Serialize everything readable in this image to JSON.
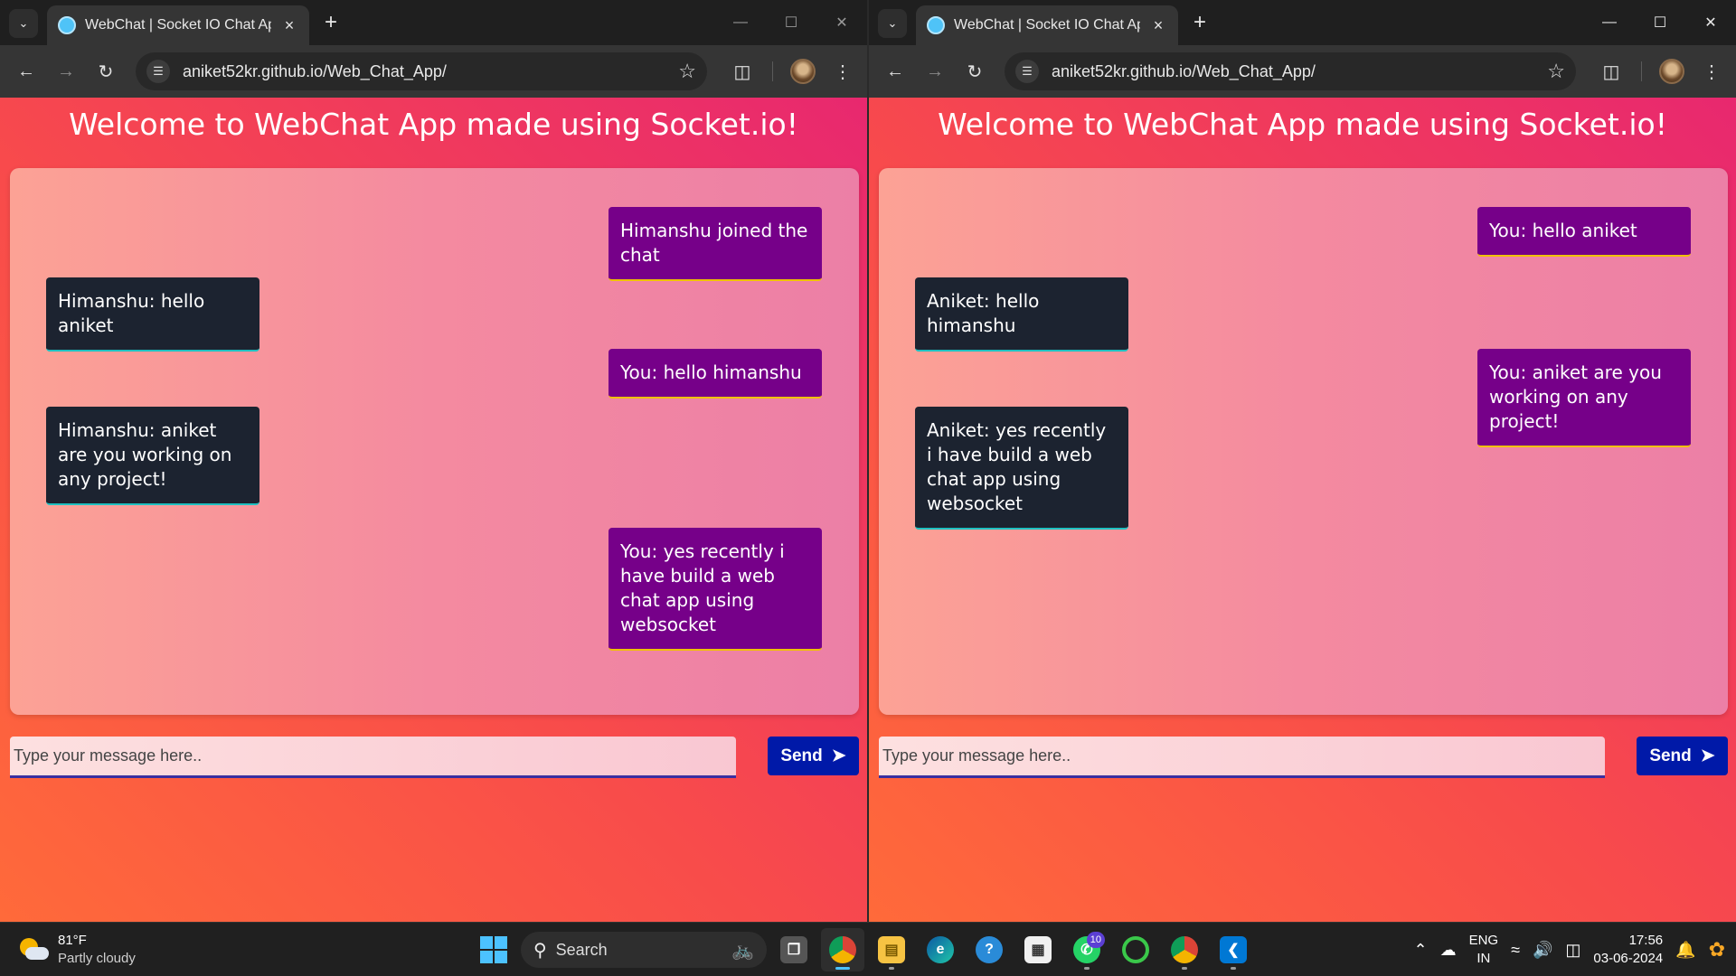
{
  "browser": {
    "tab_title": "WebChat | Socket IO Chat App",
    "url": "aniket52kr.github.io/Web_Chat_App/"
  },
  "page": {
    "heading": "Welcome to WebChat App made using Socket.io!",
    "input_placeholder": "Type your message here..",
    "send_label": "Send"
  },
  "left_window": {
    "messages": [
      {
        "side": "right",
        "text": "Himanshu joined the chat"
      },
      {
        "side": "left",
        "text": "Himanshu: hello aniket"
      },
      {
        "side": "right",
        "text": "You: hello himanshu"
      },
      {
        "side": "left",
        "text": "Himanshu: aniket are you working on any project!"
      },
      {
        "side": "right",
        "text": "You: yes recently i have build a web chat app using websocket"
      }
    ]
  },
  "right_window": {
    "messages": [
      {
        "side": "right",
        "text": "You: hello aniket"
      },
      {
        "side": "left",
        "text": "Aniket: hello himanshu"
      },
      {
        "side": "right",
        "text": "You: aniket are you working on any project!"
      },
      {
        "side": "left",
        "text": "Aniket: yes recently i have build a web chat app using websocket"
      }
    ]
  },
  "taskbar": {
    "weather_temp": "81°F",
    "weather_condition": "Partly cloudy",
    "search_label": "Search",
    "whatsapp_badge": "10",
    "language_top": "ENG",
    "language_bottom": "IN",
    "time": "17:56",
    "date": "03-06-2024"
  },
  "colors": {
    "page_gradient_start": "#ff6a3a",
    "page_gradient_end": "#e8286f",
    "self_bubble": "#760089",
    "other_bubble": "#1c2330",
    "send_button": "#0019a8"
  }
}
